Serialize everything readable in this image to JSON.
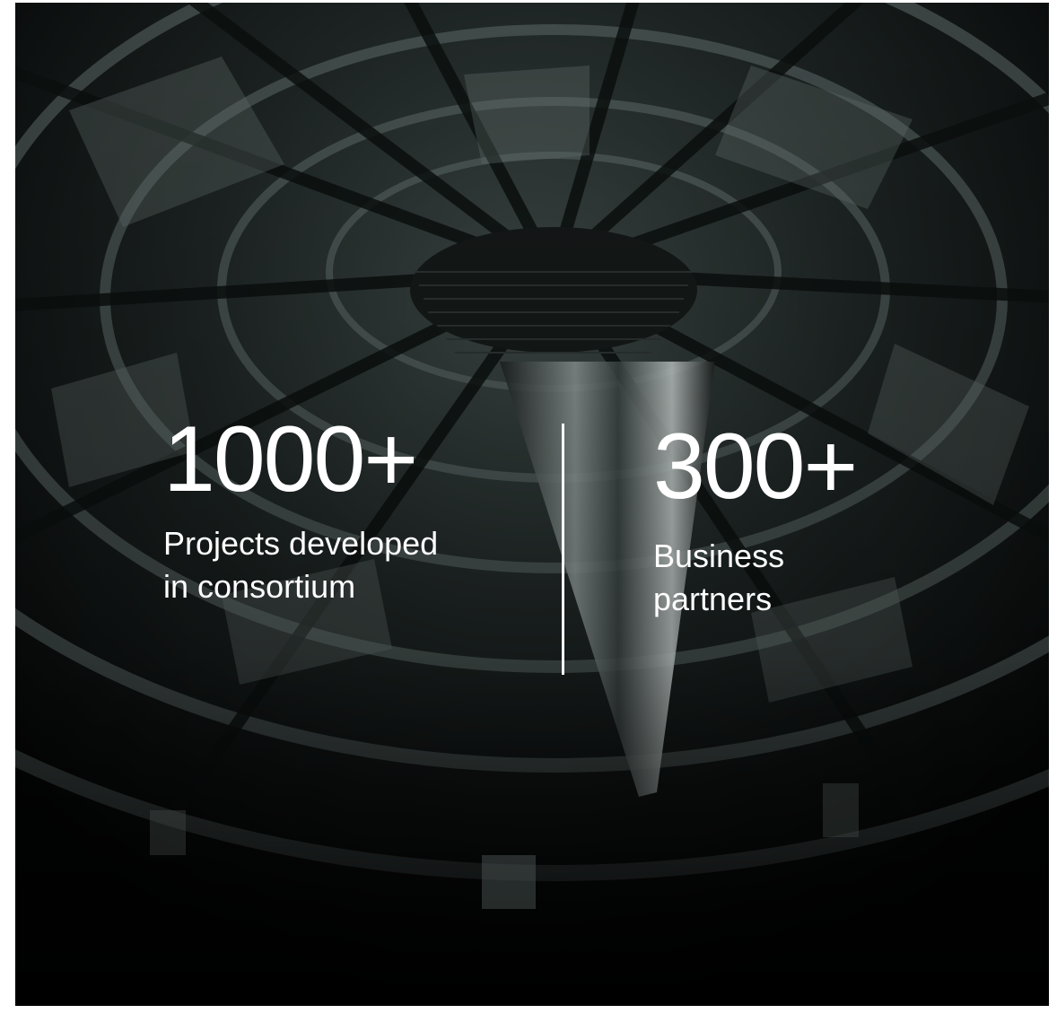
{
  "stats": [
    {
      "value": "1000+",
      "label": "Projects developed\nin consortium"
    },
    {
      "value": "300+",
      "label": "Business\npartners"
    }
  ],
  "colors": {
    "text": "#ffffff",
    "background": "#050606",
    "steel": "#6f7b78"
  }
}
